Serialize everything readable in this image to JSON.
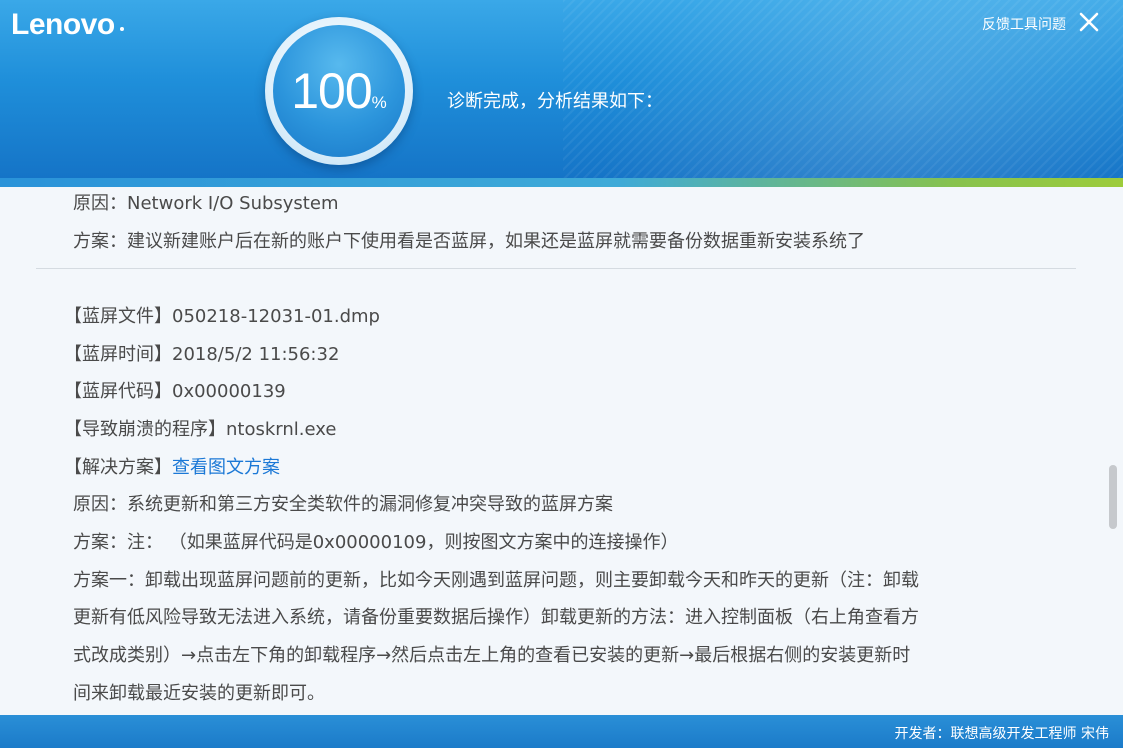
{
  "header": {
    "logo": "Lenovo",
    "feedback_label": "反馈工具问题",
    "progress_value": "100",
    "progress_unit": "%",
    "status": "诊断完成，分析结果如下："
  },
  "top_entry": {
    "cause": "原因：Network I/O Subsystem",
    "solution": "方案：建议新建账户后在新的账户下使用看是否蓝屏，如果还是蓝屏就需要备份数据重新安装系统了"
  },
  "entry": {
    "file": "【蓝屏文件】050218-12031-01.dmp",
    "time": "【蓝屏时间】2018/5/2 11:56:32",
    "code": "【蓝屏代码】0x00000139",
    "program": "【导致崩溃的程序】ntoskrnl.exe",
    "solution_prefix": "【解决方案】",
    "solution_link": "查看图文方案",
    "cause": "原因：系统更新和第三方安全类软件的漏洞修复冲突导致的蓝屏方案",
    "note": "方案：注： （如果蓝屏代码是0x00000109，则按图文方案中的连接操作）",
    "plan1_lines": [
      "方案一：卸载出现蓝屏问题前的更新，比如今天刚遇到蓝屏问题，则主要卸载今天和昨天的更新（注：卸载",
      "更新有低风险导致无法进入系统，请备份重要数据后操作）卸载更新的方法：进入控制面板（右上角查看方",
      "式改成类别）→点击左下角的卸载程序→然后点击左上角的查看已安装的更新→最后根据右侧的安装更新时",
      "间来卸载最近安装的更新即可。"
    ]
  },
  "footer": {
    "developer": "开发者：联想高级开发工程师 宋伟"
  },
  "colors": {
    "header_blue": "#1f8fda",
    "accent_green": "#9dcc3b",
    "link_blue": "#1b78d6"
  }
}
